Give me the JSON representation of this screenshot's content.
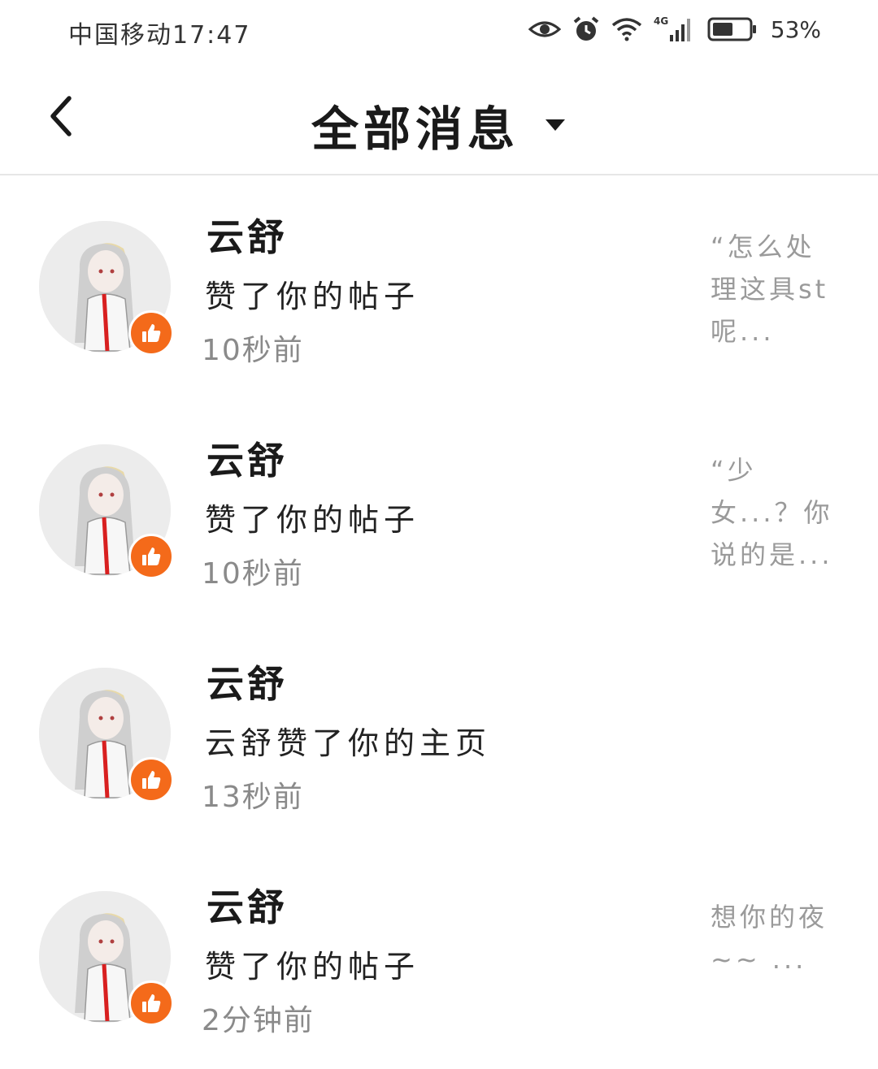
{
  "status_bar": {
    "carrier": "中国移动",
    "time": "17:47",
    "network": "4G",
    "battery": "53%",
    "icons": [
      "eye-icon",
      "alarm-icon",
      "wifi-icon",
      "signal-icon",
      "battery-icon"
    ]
  },
  "header": {
    "back_icon": "chevron-left-icon",
    "title": "全部消息",
    "dropdown_icon": "caret-down-icon"
  },
  "colors": {
    "badge": "#f46a1a",
    "divider": "#e6e6e6",
    "muted_text": "#8a8a8a",
    "preview_text": "#9a9a9a"
  },
  "notifications": [
    {
      "username": "云舒",
      "action": "赞了你的帖子",
      "time": "10秒前",
      "preview": "“怎么处理这具st呢...",
      "badge_icon": "thumbs-up-icon"
    },
    {
      "username": "云舒",
      "action": "赞了你的帖子",
      "time": "10秒前",
      "preview": "“少女...？你说的是...",
      "badge_icon": "thumbs-up-icon"
    },
    {
      "username": "云舒",
      "action": "云舒赞了你的主页",
      "time": "13秒前",
      "preview": "",
      "badge_icon": "thumbs-up-icon"
    },
    {
      "username": "云舒",
      "action": "赞了你的帖子",
      "time": "2分钟前",
      "preview": "想你的夜~~ ...",
      "badge_icon": "thumbs-up-icon"
    }
  ]
}
